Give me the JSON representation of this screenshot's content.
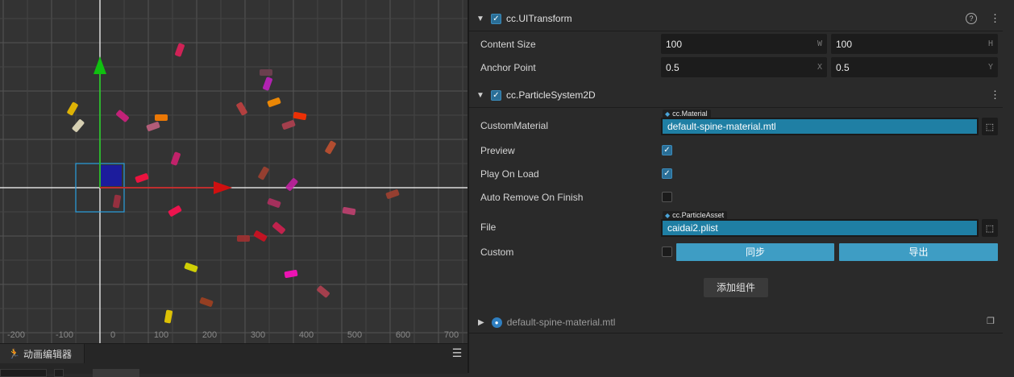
{
  "scene": {
    "x_ticks": [
      "-200",
      "-100",
      "0",
      "100",
      "200",
      "300",
      "400",
      "500",
      "600",
      "700"
    ]
  },
  "animation_panel": {
    "tab_label": "动画编辑器",
    "tab_icon": "running-figure-icon",
    "menu_icon": "hamburger-icon"
  },
  "inspector": {
    "ui_transform": {
      "title": "cc.UITransform",
      "enabled": true,
      "content_size_label": "Content Size",
      "content_size_w": "100",
      "content_size_h": "100",
      "w_axis": "W",
      "h_axis": "H",
      "anchor_point_label": "Anchor Point",
      "anchor_x": "0.5",
      "anchor_y": "0.5",
      "x_axis": "X",
      "y_axis": "Y"
    },
    "particle_system": {
      "title": "cc.ParticleSystem2D",
      "enabled": true,
      "custom_material_label": "CustomMaterial",
      "custom_material_type": "cc.Material",
      "custom_material_value": "default-spine-material.mtl",
      "preview_label": "Preview",
      "preview_checked": true,
      "play_on_load_label": "Play On Load",
      "play_on_load_checked": true,
      "auto_remove_label": "Auto Remove On Finish",
      "auto_remove_checked": false,
      "file_label": "File",
      "file_type": "cc.ParticleAsset",
      "file_value": "caidai2.plist",
      "custom_label": "Custom",
      "custom_checked": false,
      "sync_button": "同步",
      "export_button": "导出"
    },
    "add_component_button": "添加组件",
    "material_row_label": "default-spine-material.mtl"
  }
}
